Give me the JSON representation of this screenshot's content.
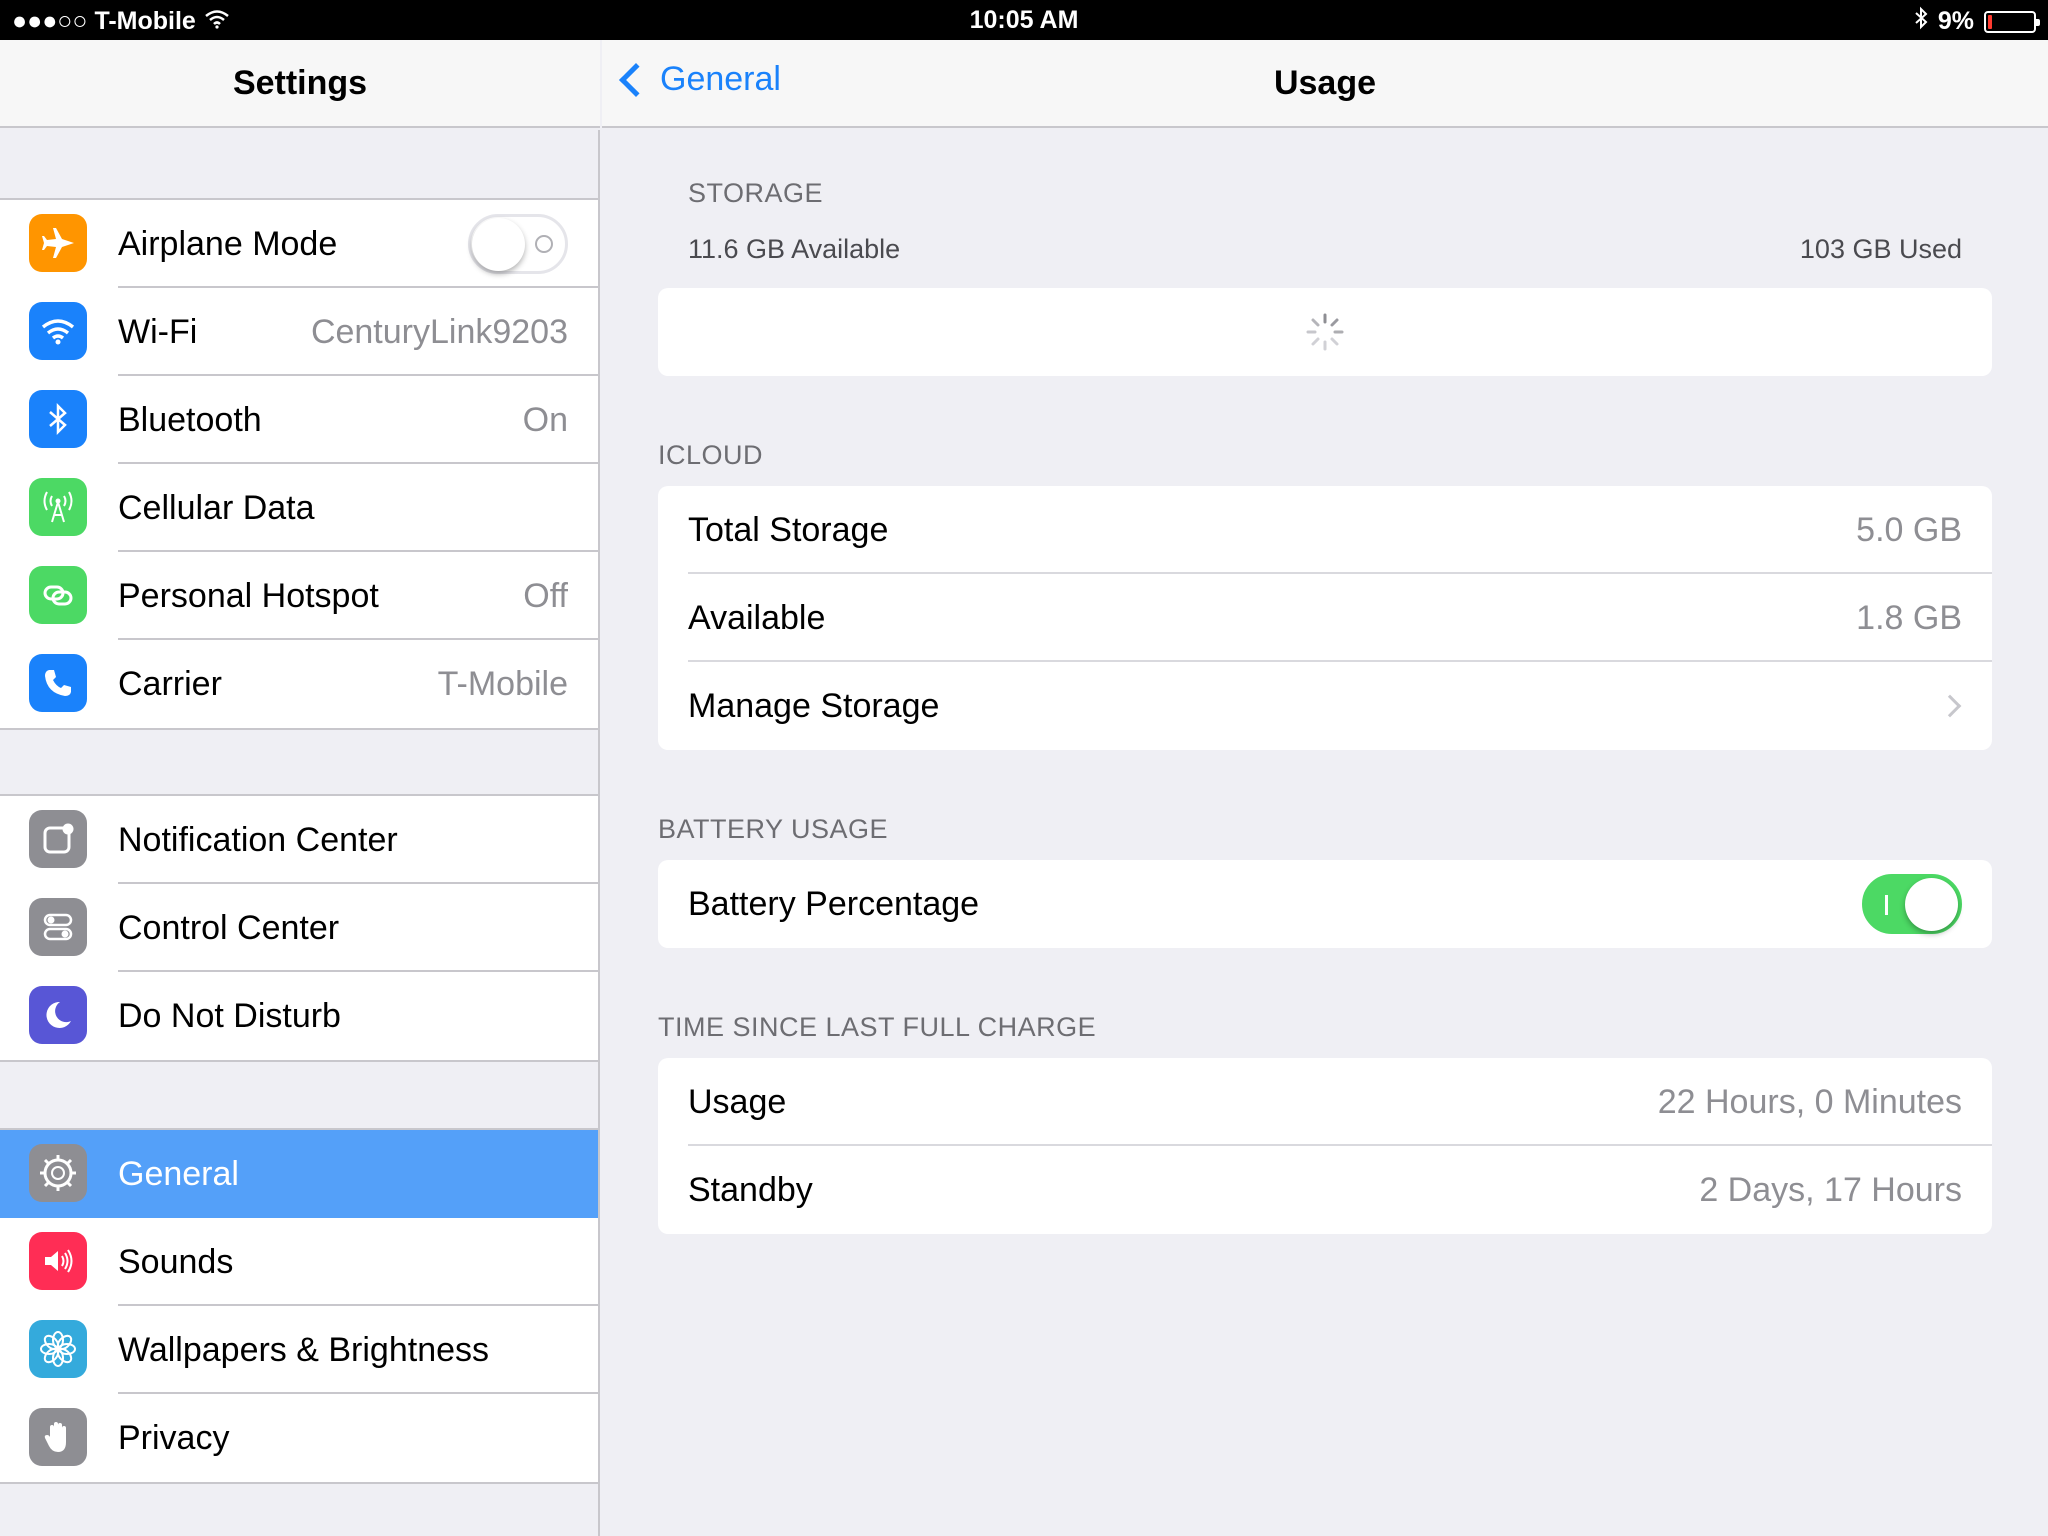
{
  "status_bar": {
    "carrier": "●●●○○ T-Mobile",
    "time": "10:05 AM",
    "battery": "9%",
    "battery_level": 0.09
  },
  "sidebar": {
    "title": "Settings",
    "groups": [
      {
        "items": [
          {
            "label": "Airplane Mode",
            "value": "",
            "icon": "airplane-icon",
            "color": "#ff9500",
            "toggle": "off"
          },
          {
            "label": "Wi-Fi",
            "value": "CenturyLink9203",
            "icon": "wifi-icon",
            "color": "#1a82fb"
          },
          {
            "label": "Bluetooth",
            "value": "On",
            "icon": "bluetooth-icon",
            "color": "#1a82fb"
          },
          {
            "label": "Cellular Data",
            "value": "",
            "icon": "cellular-icon",
            "color": "#4cd964"
          },
          {
            "label": "Personal Hotspot",
            "value": "Off",
            "icon": "hotspot-icon",
            "color": "#4cd964"
          },
          {
            "label": "Carrier",
            "value": "T-Mobile",
            "icon": "phone-icon",
            "color": "#1a82fb"
          }
        ]
      },
      {
        "items": [
          {
            "label": "Notification Center",
            "value": "",
            "icon": "notification-center-icon",
            "color": "#8e8e93"
          },
          {
            "label": "Control Center",
            "value": "",
            "icon": "control-center-icon",
            "color": "#8e8e93"
          },
          {
            "label": "Do Not Disturb",
            "value": "",
            "icon": "moon-icon",
            "color": "#5856d6"
          }
        ]
      },
      {
        "items": [
          {
            "label": "General",
            "value": "",
            "icon": "gear-icon",
            "color": "#8e8e93",
            "selected": true
          },
          {
            "label": "Sounds",
            "value": "",
            "icon": "speaker-icon",
            "color": "#ff2d55"
          },
          {
            "label": "Wallpapers & Brightness",
            "value": "",
            "icon": "flower-icon",
            "color": "#34aadc"
          },
          {
            "label": "Privacy",
            "value": "",
            "icon": "hand-icon",
            "color": "#8e8e93"
          }
        ]
      }
    ]
  },
  "detail": {
    "back_label": "General",
    "title": "Usage",
    "storage": {
      "header": "STORAGE",
      "available": "11.6 GB Available",
      "used": "103 GB Used"
    },
    "icloud": {
      "header": "ICLOUD",
      "rows": [
        {
          "label": "Total Storage",
          "value": "5.0 GB"
        },
        {
          "label": "Available",
          "value": "1.8 GB"
        },
        {
          "label": "Manage Storage",
          "value": ""
        }
      ]
    },
    "battery_usage": {
      "header": "BATTERY USAGE",
      "label": "Battery Percentage",
      "toggle": "on"
    },
    "time_since_charge": {
      "header": "TIME SINCE LAST FULL CHARGE",
      "rows": [
        {
          "label": "Usage",
          "value": "22 Hours, 0 Minutes"
        },
        {
          "label": "Standby",
          "value": "2 Days, 17 Hours"
        }
      ]
    }
  }
}
